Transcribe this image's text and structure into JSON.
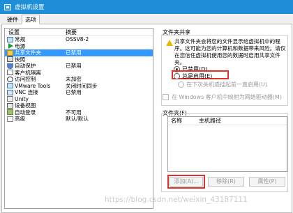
{
  "window": {
    "title": "虚拟机设置"
  },
  "tabs": [
    {
      "label": "硬件"
    },
    {
      "label": "选项"
    }
  ],
  "device_list": {
    "headers": {
      "setting": "设置",
      "summary": "摘要"
    },
    "items": [
      {
        "name": "常规",
        "value": "OSSV8-2",
        "icon": "vm-icon"
      },
      {
        "name": "电源",
        "value": "",
        "icon": "power-play-icon"
      },
      {
        "name": "共享文件夹",
        "value": "已禁用",
        "icon": "shared-folder-icon"
      },
      {
        "name": "快照",
        "value": "",
        "icon": "snapshot-icon"
      },
      {
        "name": "自动保护",
        "value": "已禁用",
        "icon": "autoprotect-icon"
      },
      {
        "name": "客户机隔离",
        "value": "",
        "icon": "isolation-icon"
      },
      {
        "name": "访问控制",
        "value": "未加密",
        "icon": "access-control-icon"
      },
      {
        "name": "VMware Tools",
        "value": "关闭时间同步",
        "icon": "vmware-tools-icon"
      },
      {
        "name": "VNC 连接",
        "value": "已禁用",
        "icon": "vnc-icon"
      },
      {
        "name": "Unity",
        "value": "",
        "icon": "unity-icon"
      },
      {
        "name": "设备视图",
        "value": "",
        "icon": "device-view-icon"
      },
      {
        "name": "自动登录",
        "value": "不可用",
        "icon": "autologin-icon"
      },
      {
        "name": "高级",
        "value": "默认/默认",
        "icon": "advanced-icon"
      }
    ]
  },
  "folder_sharing": {
    "group_label": "文件夹共享",
    "warning": "共享文件夹会将您的文件显示给虚拟机中的程序。这可能为您的计算机和数据带来风险。请仅在您信任虚拟机使用您的数据时启用共享文件夹。",
    "options": [
      {
        "label": "已禁用(D)",
        "checked": true,
        "enabled": true
      },
      {
        "label": "总是启用(E)",
        "checked": false,
        "enabled": true
      },
      {
        "label": "在下次关机或挂起前一直启用(U)",
        "checked": false,
        "enabled": false
      }
    ],
    "map_drive_label": "在 Windows 客户机中映射为网络驱动器(M)"
  },
  "folders": {
    "group_label": "文件夹(F)",
    "columns": {
      "name": "名称",
      "host_path": "主机路径"
    },
    "buttons": {
      "add": "添加(A)...",
      "remove": "移除(R)",
      "properties": "属性(P)"
    }
  },
  "watermark": "https://blog.csdn.net/weixin_43187111"
}
